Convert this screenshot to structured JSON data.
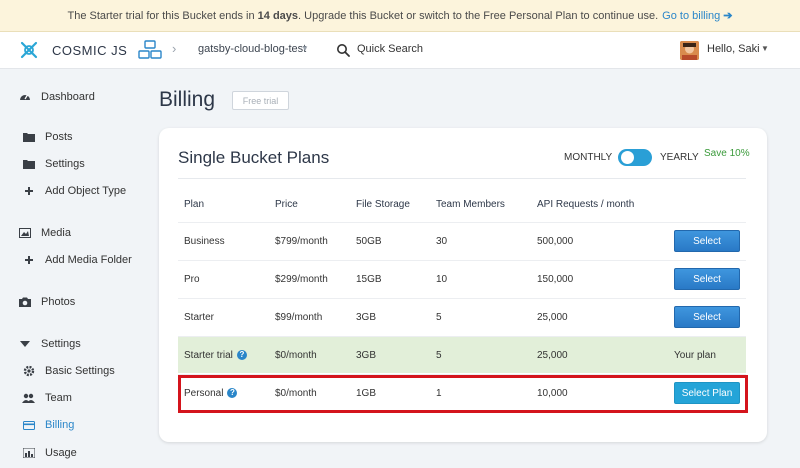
{
  "banner": {
    "text_before": "The Starter trial for this Bucket ends in",
    "days": "14 days",
    "text_after": ". Upgrade this Bucket or switch to the Free Personal Plan to continue use.",
    "link": "Go to billing",
    "arrow": "➔"
  },
  "topbar": {
    "logo": "COSMIC JS",
    "bucket": "gatsby-cloud-blog-test",
    "separator": "›",
    "caret": "▼",
    "search": "Quick Search",
    "user": "Hello, Saki",
    "user_caret": "▼"
  },
  "sidebar": {
    "items": [
      {
        "label": "Dashboard",
        "icon": "dashboard-icon"
      },
      {
        "label": "Posts",
        "icon": "folder-icon"
      },
      {
        "label": "Settings",
        "icon": "folder-icon"
      },
      {
        "label": "Add Object Type",
        "icon": "plus-icon"
      },
      {
        "label": "Media",
        "icon": "image-icon"
      },
      {
        "label": "Add Media Folder",
        "icon": "plus-icon"
      },
      {
        "label": "Photos",
        "icon": "camera-icon"
      },
      {
        "label": "Settings",
        "icon": "caret-down-icon"
      },
      {
        "label": "Basic Settings",
        "icon": "gear-icon"
      },
      {
        "label": "Team",
        "icon": "users-icon"
      },
      {
        "label": "Billing",
        "icon": "credit-card-icon"
      },
      {
        "label": "Usage",
        "icon": "bar-chart-icon"
      }
    ]
  },
  "page": {
    "title": "Billing",
    "badge": "Free trial"
  },
  "plans": {
    "title": "Single Bucket Plans",
    "monthly": "MONTHLY",
    "yearly": "YEARLY",
    "save": "Save 10%",
    "headers": [
      "Plan",
      "Price",
      "File Storage",
      "Team Members",
      "API Requests / month"
    ],
    "rows": [
      {
        "plan": "Business",
        "price": "$799/month",
        "storage": "50GB",
        "members": "30",
        "requests": "500,000",
        "action": "Select"
      },
      {
        "plan": "Pro",
        "price": "$299/month",
        "storage": "15GB",
        "members": "10",
        "requests": "150,000",
        "action": "Select"
      },
      {
        "plan": "Starter",
        "price": "$99/month",
        "storage": "3GB",
        "members": "5",
        "requests": "25,000",
        "action": "Select"
      },
      {
        "plan": "Starter trial",
        "price": "$0/month",
        "storage": "3GB",
        "members": "5",
        "requests": "25,000",
        "action": "Your plan"
      },
      {
        "plan": "Personal",
        "price": "$0/month",
        "storage": "1GB",
        "members": "1",
        "requests": "10,000",
        "action": "Select Plan"
      }
    ],
    "help_glyph": "?"
  },
  "colors": {
    "accent": "#2a86c9",
    "highlight": "#d4141c",
    "current_plan_row": "#e2efd9",
    "banner": "#fcf4dc"
  }
}
